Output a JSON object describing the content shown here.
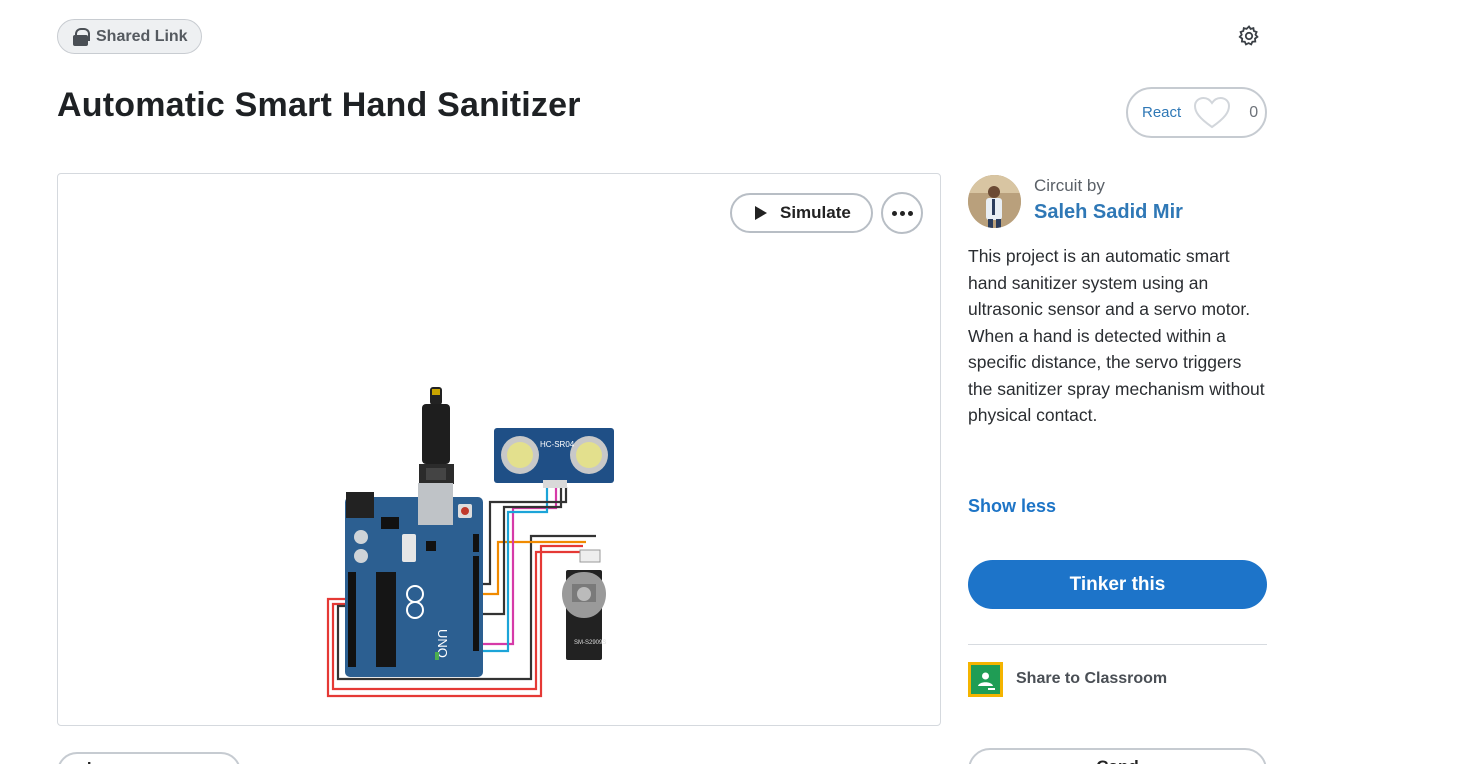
{
  "header": {
    "shared_label": "Shared Link",
    "title": "Automatic Smart Hand Sanitizer",
    "react_label": "React",
    "react_count": "0"
  },
  "viewer": {
    "simulate_label": "Simulate",
    "arduino_label": "UNO",
    "sensor_label": "HC-SR04",
    "servo_label": "SM-S2909S"
  },
  "sidebar": {
    "circuit_by": "Circuit by",
    "author": "Saleh Sadid Mir",
    "description": "This project is an automatic smart hand sanitizer system using an ultrasonic sensor and a servo motor. When a hand is detected within a specific distance, the servo triggers the sanitizer spray mechanism without physical contact.",
    "show_less": "Show less",
    "tinker_label": "Tinker this",
    "classroom_label": "Share to Classroom",
    "bottom_left_label": "I",
    "bottom_right_label": "Cand"
  },
  "colors": {
    "accent": "#1d74c9",
    "link": "#2f78b6",
    "arduino_blue": "#2c5f91",
    "wire_red": "#e53935",
    "wire_orange": "#f08a00",
    "wire_magenta": "#d63aa8",
    "wire_cyan": "#1ca4d8",
    "wire_dark": "#333333"
  }
}
